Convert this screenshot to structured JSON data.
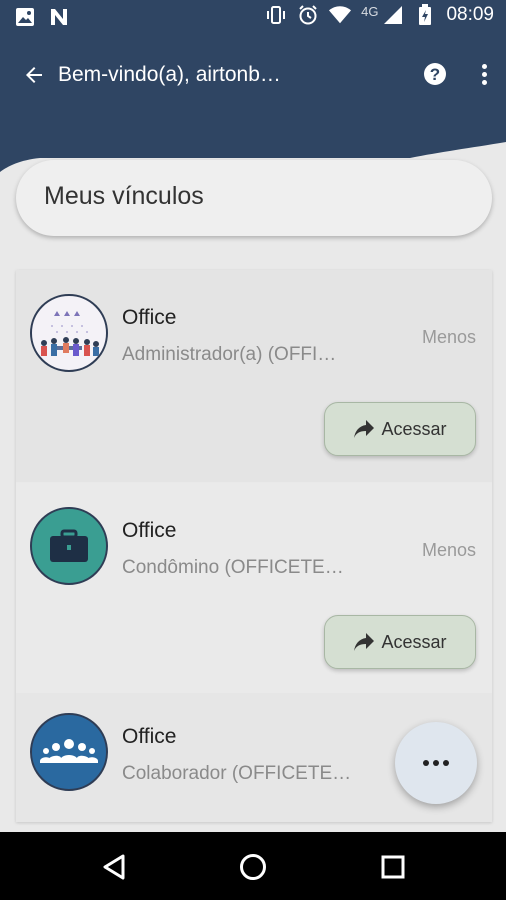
{
  "status_bar": {
    "time": "08:09",
    "network_type": "4G",
    "icons_left": [
      "image-icon",
      "n-app-icon"
    ],
    "icons_right": [
      "vibrate-icon",
      "alarm-icon",
      "wifi-icon",
      "signal-icon",
      "battery-icon"
    ]
  },
  "app_bar": {
    "title": "Bem-vindo(a), airtonb…",
    "back_icon": "arrow-back-icon",
    "help_icon": "help-circle-icon",
    "menu_icon": "more-vert-icon"
  },
  "section": {
    "title": "Meus vínculos"
  },
  "cards": [
    {
      "name": "Office",
      "role": "Administrador(a) (OFFI…",
      "toggle_label": "Menos",
      "access_label": "Acessar",
      "avatar_icon": "team-illustration-icon"
    },
    {
      "name": "Office",
      "role": "Condômino (OFFICETE…",
      "toggle_label": "Menos",
      "access_label": "Acessar",
      "avatar_icon": "briefcase-icon"
    },
    {
      "name": "Office",
      "role": "Colaborador (OFFICETE…",
      "avatar_icon": "group-icon"
    }
  ],
  "fab": {
    "icon": "more-horiz-icon"
  },
  "nav_bar": {
    "back_icon": "nav-back-icon",
    "home_icon": "nav-home-icon",
    "recents_icon": "nav-recents-icon"
  },
  "colors": {
    "header": "#2f4563",
    "background": "#e9e9e9",
    "access_button": "#d5dfd2",
    "avatar_teal": "#3a9e92",
    "avatar_blue": "#2a69a0"
  }
}
